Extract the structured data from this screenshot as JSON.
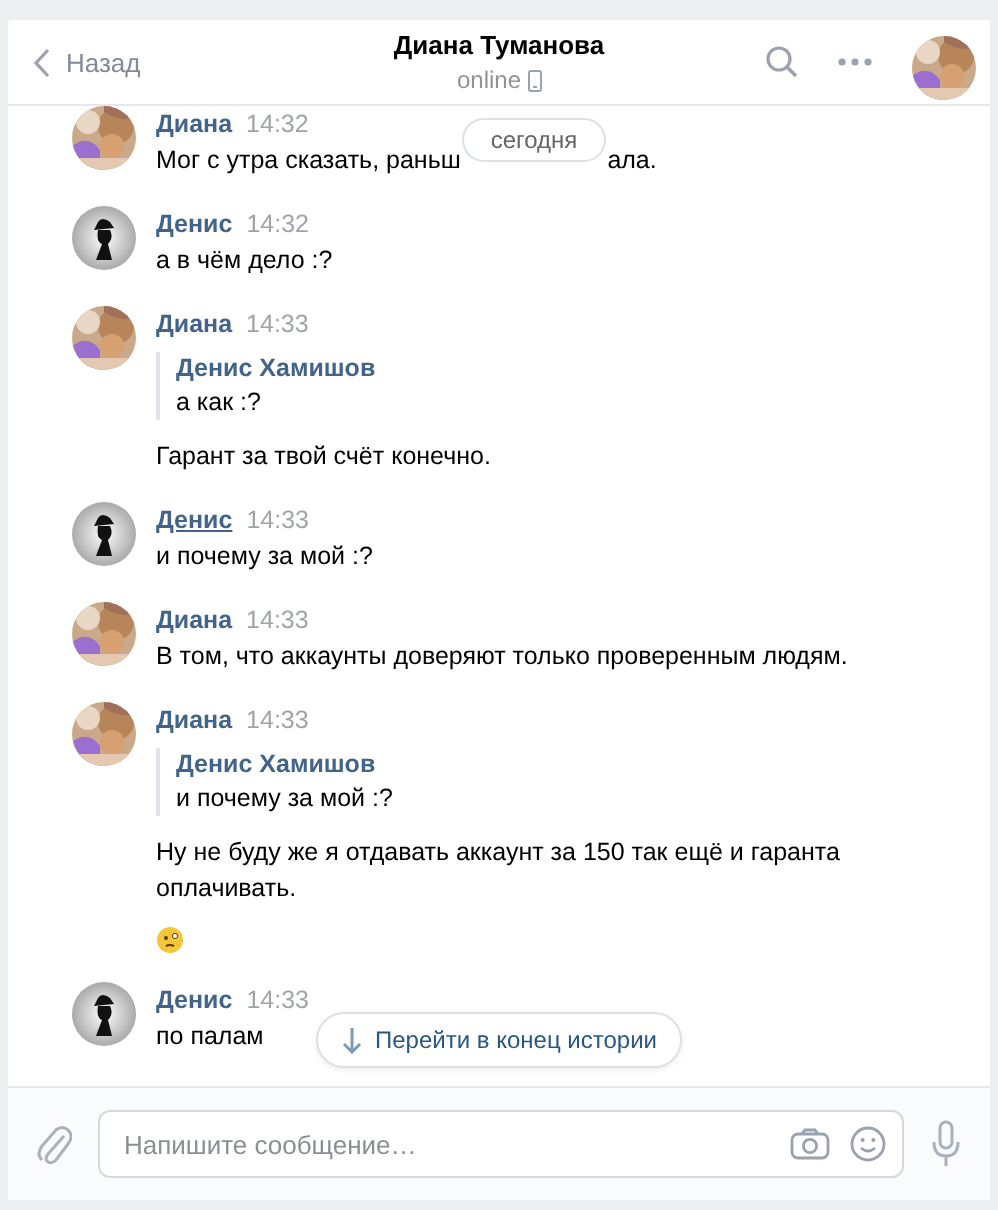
{
  "header": {
    "back_label": "Назад",
    "title": "Диана Туманова",
    "status": "online"
  },
  "date_pill": "сегодня",
  "messages": [
    {
      "author": "Диана",
      "time": "14:32",
      "hovered": false,
      "parts": [
        {
          "kind": "split_text",
          "before": "Мог с утра сказать, раньш",
          "after": "ала."
        }
      ]
    },
    {
      "author": "Денис",
      "time": "14:32",
      "kind": "silhouette",
      "hovered": false,
      "parts": [
        {
          "kind": "text",
          "text": "а в чём дело :?"
        }
      ]
    },
    {
      "author": "Диана",
      "time": "14:33",
      "hovered": false,
      "parts": [
        {
          "kind": "quote",
          "author": "Денис Хамишов",
          "text": "а как :?"
        },
        {
          "kind": "text",
          "text": "Гарант за твой счёт конечно."
        }
      ]
    },
    {
      "author": "Денис",
      "time": "14:33",
      "kind": "silhouette",
      "hovered": true,
      "parts": [
        {
          "kind": "text",
          "text": "и почему за мой :?"
        }
      ]
    },
    {
      "author": "Диана",
      "time": "14:33",
      "hovered": false,
      "parts": [
        {
          "kind": "text",
          "text": "В том, что аккаунты доверяют только проверенным людям."
        }
      ]
    },
    {
      "author": "Диана",
      "time": "14:33",
      "hovered": false,
      "parts": [
        {
          "kind": "quote",
          "author": "Денис Хамишов",
          "text": "и почему за мой :?"
        },
        {
          "kind": "text",
          "text": "Ну не буду же я отдавать аккаунт за 150 так ещё и гаранта оплачивать."
        },
        {
          "kind": "emoji"
        }
      ]
    },
    {
      "author": "Денис",
      "time": "14:33",
      "kind": "silhouette",
      "hovered": false,
      "parts": [
        {
          "kind": "text",
          "text": "по палам"
        }
      ]
    }
  ],
  "jump_button": "Перейти в конец истории",
  "composer": {
    "placeholder": "Напишите сообщение…"
  }
}
